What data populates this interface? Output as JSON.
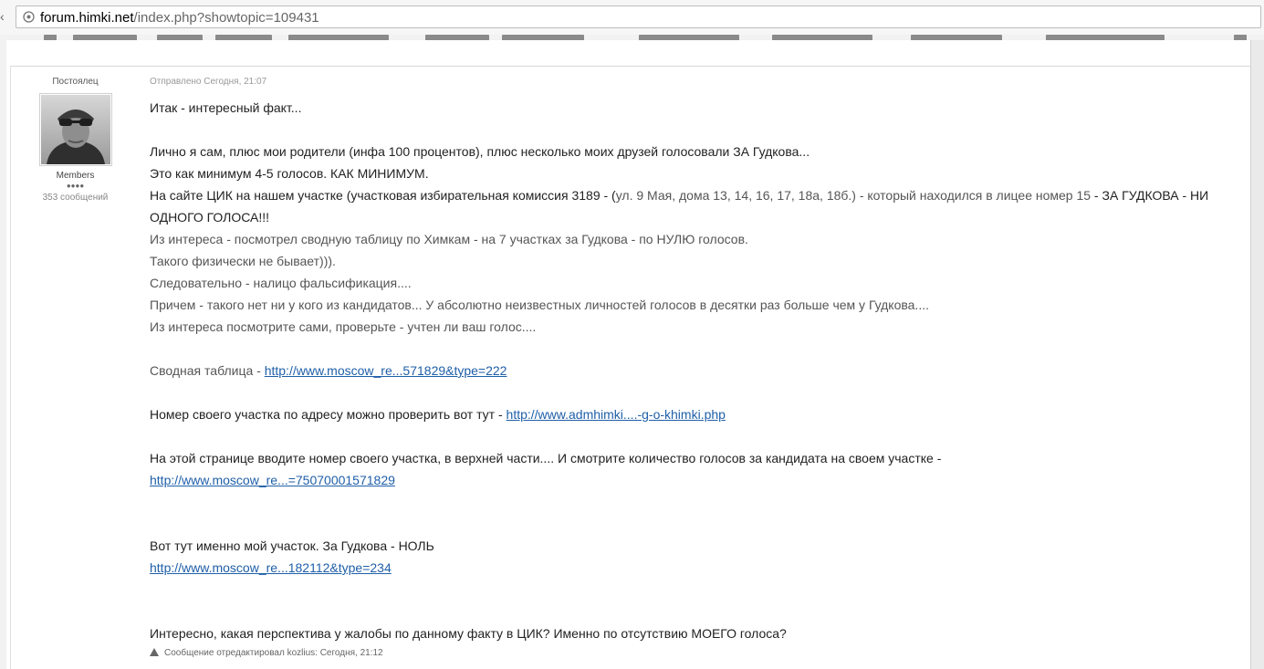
{
  "browser": {
    "url_host": "forum.himki.net",
    "url_path": "/index.php?showtopic=109431"
  },
  "author": {
    "rank": "Постоялец",
    "group": "Members",
    "pips": "●●●●",
    "posts": "353 сообщений"
  },
  "post": {
    "posted": "Отправлено Сегодня, 21:07",
    "line1": "Итак - интересный факт...",
    "line2": "Лично я сам, плюс мои родители (инфа 100 процентов), плюс несколько моих друзей голосовали ЗА Гудкова...",
    "line3": "Это как минимум 4-5 голосов. КАК МИНИМУМ.",
    "line4a": "На сайте ЦИК на нашем участке (участковая избирательная комиссия 3189 - (",
    "line4b": "ул. 9 Мая, дома 13, 14, 16, 17, 18а, 18б.) - который находился в лицее номер 15",
    "line4c": "  - ЗА ГУДКОВА - НИ ОДНОГО ГОЛОСА!!!",
    "line5": "Из интереса - посмотрел сводную таблицу по Химкам - на 7 участках за Гудкова - по НУЛЮ голосов.",
    "line6": "Такого физически не бывает))).",
    "line7": "Следовательно - налицо фальсификация....",
    "line8": "Причем - такого нет ни у кого из кандидатов... У абсолютно неизвестных личностей голосов в десятки раз больше чем у Гудкова....",
    "line9": "Из интереса посмотрите сами, проверьте - учтен ли ваш голос....",
    "summary_label": "Сводная таблица - ",
    "summary_link": "http://www.moscow_re...571829&type=222",
    "check_label": "Номер своего участка по адресу можно проверить вот тут  - ",
    "check_link": "http://www.admhimki....-g-o-khimki.php",
    "enter_text": "На этой странице вводите номер своего участка, в верхней части.... И смотрите количество голосов за кандидата на своем участке -",
    "enter_link": "http://www.moscow_re...=75070001571829",
    "mine_text": "Вот тут именно мой участок. За Гудкова - НОЛЬ",
    "mine_link": "http://www.moscow_re...182112&type=234",
    "question": "Интересно, какая перспектива у жалобы по данному факту в ЦИК? Именно по отсутствию МОЕГО голоса?",
    "edited": "Сообщение отредактировал kozlius: Сегодня, 21:12"
  }
}
